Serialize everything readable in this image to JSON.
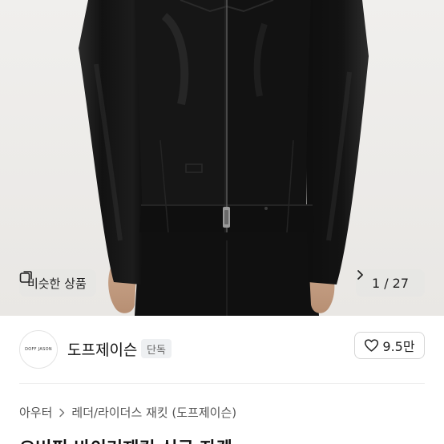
{
  "gallery": {
    "similar_label": "비슷한 상품",
    "page_counter": "1 / 27"
  },
  "shop": {
    "logo_text": "DOFF JASON",
    "name": "도프제이슨",
    "badge": "단독",
    "like_count": "9.5만"
  },
  "breadcrumb": {
    "items": [
      "아우터",
      "레더/라이더스 재킷 (도프제이슨)"
    ]
  },
  "product": {
    "title_partial": "오버핏 바이커재킷 싱글 자켓"
  },
  "colors": {
    "background": "#ffffff",
    "jacket": "#141414",
    "badge_bg": "#eef0f2",
    "overlay_bg": "#e6e6e4"
  }
}
